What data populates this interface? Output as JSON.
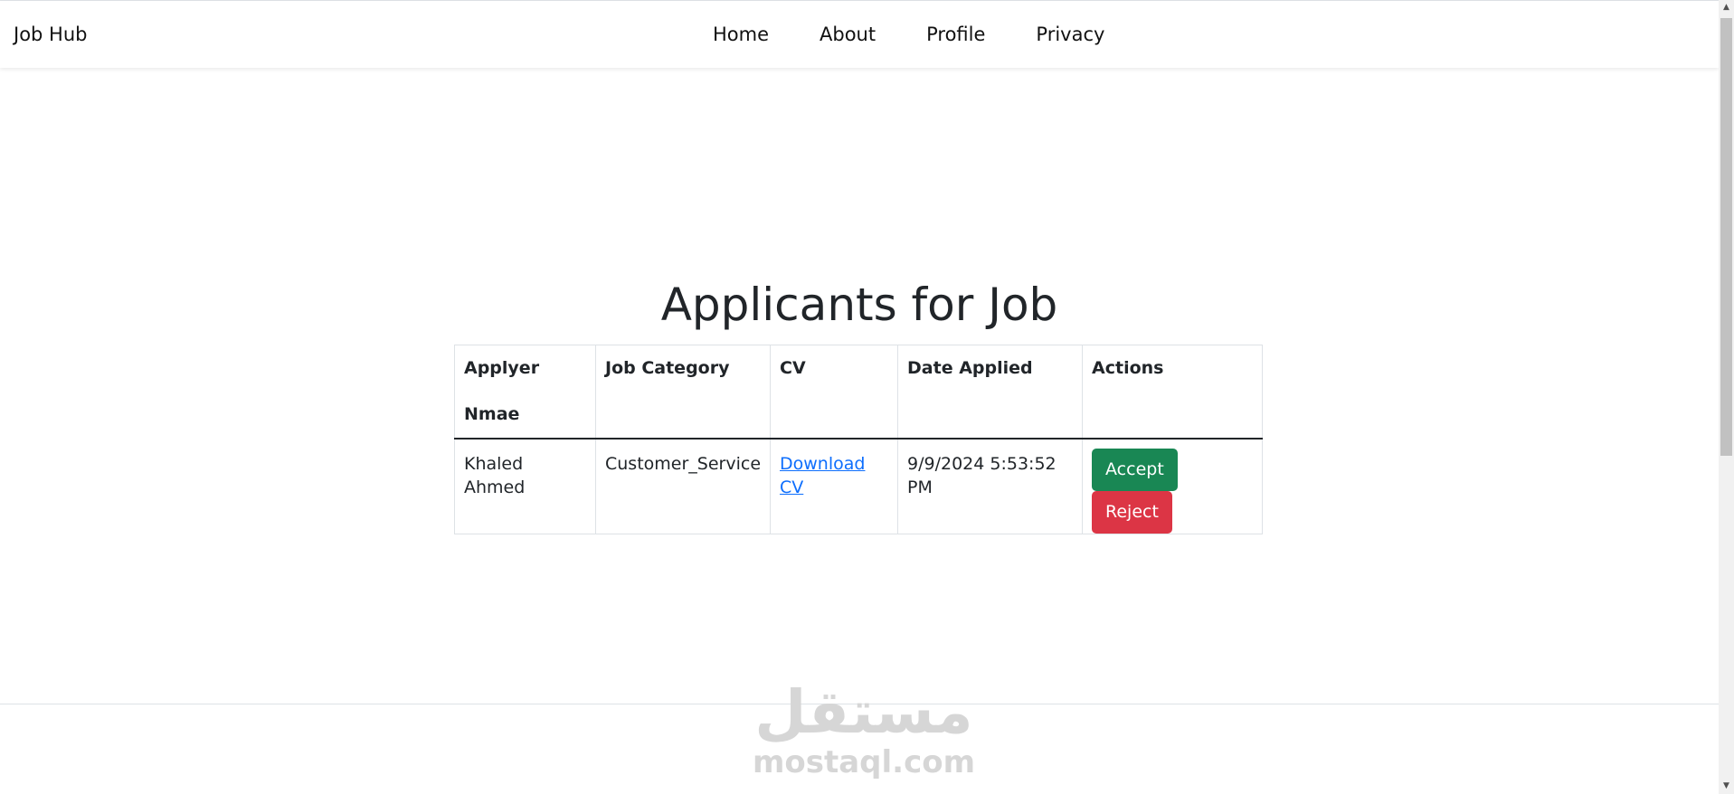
{
  "navbar": {
    "brand": "Job Hub",
    "links": [
      "Home",
      "About",
      "Profile",
      "Privacy"
    ]
  },
  "page": {
    "title": "Applicants for Job"
  },
  "table": {
    "headers": [
      "Applyer Nmae",
      "Job Category",
      "CV",
      "Date Applied",
      "Actions"
    ],
    "rows": [
      {
        "name": "Khaled Ahmed",
        "category": "Customer_Service",
        "cv_link": "Download CV",
        "date": "9/9/2024 5:53:52 PM",
        "accept_label": "Accept",
        "reject_label": "Reject"
      }
    ]
  },
  "watermark": {
    "arabic": "مستقل",
    "latin": "mostaql.com"
  },
  "colors": {
    "accept": "#198754",
    "reject": "#dc3545",
    "link": "#0d6efd"
  }
}
